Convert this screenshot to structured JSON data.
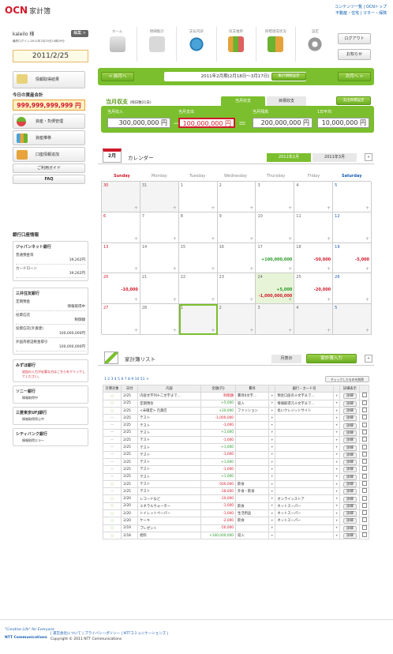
{
  "header": {
    "logo_main": "OCN",
    "logo_sub": "家計簿",
    "links_line1": "コンテンツ一覧 | OCNトップ",
    "links_line2": "不動産・住宅 | マネー・保険"
  },
  "nav": {
    "items": [
      "ホーム",
      "明細集計",
      "支払内訳",
      "収支推移",
      "目標達成状況",
      "設定"
    ],
    "login_button": "ログアウト",
    "notice_button": "お知らせ"
  },
  "user": {
    "name": "kaleilo 様",
    "edit": "編集 >",
    "last_login": "最終ログイン:2011年2月25日14時29分",
    "date": "2011/2/25"
  },
  "sidebar": {
    "fetch_button": "情報取得結果",
    "assets_label": "今日の資産合計",
    "assets_value": "999,999,999,999 円",
    "menu": [
      "資産・負債管理",
      "資産推移",
      "口座情報追加",
      "ご利用ガイド",
      "FAQ"
    ],
    "accounts_title": "銀行口座情報",
    "banks": [
      {
        "name": "ジャパンネット銀行",
        "rows": [
          [
            "普通預金等",
            "39,262円"
          ],
          [
            "カードローン",
            "39,262円"
          ]
        ]
      },
      {
        "name": "三井住友銀行",
        "rows": [
          [
            "定期預金",
            "情報取得中"
          ],
          [
            "投資信託",
            "制御額"
          ],
          [
            "投資信託(外貨建)",
            "100,000,000円"
          ],
          [
            "外国為替証拠金取引",
            "100,000,000円"
          ]
        ]
      },
      {
        "name": "みずほ銀行",
        "note": "追加の入力が必要な方はこちらをクリックしてください。"
      },
      {
        "name": "ソニー銀行",
        "note": "情報取得中"
      },
      {
        "name": "三菱東京UFJ銀行",
        "note": "情報取得停止中"
      },
      {
        "name": "シティバンク銀行",
        "note": "情報取得エラー"
      }
    ]
  },
  "period_bar": {
    "prev": "< 前月へ",
    "next": "次月へ >",
    "label": "2011年2月期(2月18日～3月17日)",
    "setting": "集計期間設定"
  },
  "summary": {
    "title": "当月収支",
    "subtitle": "(残日数21日)",
    "tab_income": "当月収支",
    "tab_goal": "目標収支",
    "tab_settings": "支出目標設定",
    "income_label": "当月収入",
    "income_value": "300,000,000 円",
    "expense_label": "当月支出",
    "expense_value": "100,000,000 円",
    "balance_label": "当月残高",
    "balance_value": "200,000,000 円",
    "daily_label": "1日平均",
    "daily_value": "10,000,000 円"
  },
  "calendar": {
    "month_badge": "2月",
    "title": "カレンダー",
    "tab_feb": "2011年2月",
    "tab_mar": "2011年3月",
    "weekdays": [
      "Sunday",
      "Monday",
      "Tuesday",
      "Wednesday",
      "Thursday",
      "Friday",
      "Saturday"
    ],
    "days": [
      "30",
      "31",
      "1",
      "2",
      "3",
      "4",
      "5",
      "6",
      "7",
      "8",
      "9",
      "10",
      "11",
      "12",
      "13",
      "14",
      "15",
      "16",
      "17",
      "18",
      "19",
      "20",
      "21",
      "22",
      "23",
      "24",
      "25",
      "26",
      "27",
      "28",
      "1",
      "2",
      "3",
      "4",
      "5"
    ],
    "amounts": [
      {
        "cell": 18,
        "text": "+100,000,000",
        "color": "#2a9a2a"
      },
      {
        "cell": 19,
        "text": "-50,000",
        "color": "#d01a2b"
      },
      {
        "cell": 20,
        "text": "-5,000",
        "color": "#d01a2b"
      },
      {
        "cell": 21,
        "text": "-10,000",
        "color": "#d01a2b"
      },
      {
        "cell": 26,
        "text": "-20,000",
        "color": "#d01a2b"
      },
      {
        "cell": 25,
        "text": "+5,000",
        "color": "#2a9a2a"
      },
      {
        "cell": 25,
        "text": "-1,000,000,000",
        "color": "#d01a2b"
      }
    ]
  },
  "list": {
    "title": "家計簿リスト",
    "view_button": "月表示",
    "add_button": "家計簿入力",
    "filter_button": "チェックしたものを削除",
    "pages": "1 2 3 4 5 6 7 8 9 10 51 >",
    "headers": [
      "計算対象",
      "日付",
      "内容",
      "金額(円)",
      "費目",
      "",
      "銀行・カード名",
      "",
      "詳細表示",
      ""
    ],
    "rows": [
      [
        "○",
        "2/25",
        "内容文字列十二文字まで…",
        "制限額",
        "費目6文字…",
        "預金口座名十文字まで…",
        "詳細"
      ],
      [
        "○",
        "2/25",
        "定期預金",
        "+5,000",
        "収入",
        "情報取得元十文字まで…",
        "詳細"
      ],
      [
        "○",
        "2/25",
        "<未確定> 百貨店",
        "+20,000",
        "ファッション",
        "長いクレジットサイト",
        "詳細"
      ],
      [
        "—",
        "2/25",
        "テスト",
        "-1,000,000",
        "",
        "",
        "詳細"
      ],
      [
        "—",
        "2/25",
        "テスト",
        "-1,000",
        "",
        "",
        "詳細"
      ],
      [
        "—",
        "2/25",
        "テスト",
        "+1,000",
        "",
        "",
        "詳細"
      ],
      [
        "—",
        "2/25",
        "テスト",
        "-1,000",
        "",
        "",
        "詳細"
      ],
      [
        "—",
        "2/25",
        "テスト",
        "+1,000",
        "",
        "",
        "詳細"
      ],
      [
        "—",
        "2/25",
        "テスト",
        "-1,000",
        "",
        "",
        "詳細"
      ],
      [
        "—",
        "2/25",
        "テスト",
        "+1,000",
        "",
        "",
        "詳細"
      ],
      [
        "—",
        "2/25",
        "テスト",
        "-1,000",
        "",
        "",
        "詳細"
      ],
      [
        "—",
        "2/25",
        "テスト",
        "+1,000",
        "",
        "",
        "詳細"
      ],
      [
        "○",
        "2/25",
        "テスト",
        "-500,000",
        "飲食",
        "",
        "詳細"
      ],
      [
        "—",
        "2/25",
        "テスト",
        "-18,000",
        "外食・飲食",
        "",
        "詳細"
      ],
      [
        "○",
        "2/20",
        "レコードなど",
        "-10,000",
        "",
        "オンラインストア",
        "詳細"
      ],
      [
        "○",
        "2/20",
        "ミネラルウォーター",
        "-1,000",
        "飲食",
        "ネットスーパー",
        "詳細"
      ],
      [
        "○",
        "2/20",
        "トイレットペーパー",
        "-1,000",
        "生活用品",
        "ネットスーパー",
        "詳細"
      ],
      [
        "○",
        "2/20",
        "ケーキ",
        "-2,000",
        "飲食",
        "ネットスーパー",
        "詳細"
      ],
      [
        "○",
        "2/19",
        "プレゼント",
        "-50,000",
        "",
        "",
        "詳細"
      ],
      [
        "○",
        "2/18",
        "給料",
        "+100,000,000",
        "収入",
        "",
        "詳細"
      ]
    ]
  },
  "footer": {
    "tagline": "\"Creative Life\" for Everyone",
    "company": "NTT Communications",
    "links": "| 運営会社について | プライバシーポリシー | NTTコミュニケーションズ |",
    "copyright": "Copyright © 2011 NTT Communications"
  },
  "colors": {
    "accent_green": "#7bbf2e",
    "assets_red": "#d01a2b"
  }
}
